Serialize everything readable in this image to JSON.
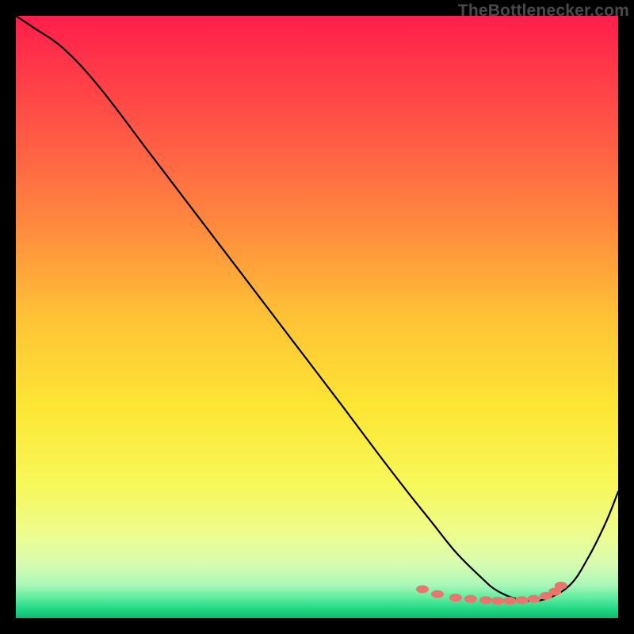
{
  "watermark": "TheBottlenecker.com",
  "chart_data": {
    "type": "line",
    "title": "",
    "xlabel": "",
    "ylabel": "",
    "xlim": [
      0,
      100
    ],
    "ylim": [
      0,
      100
    ],
    "background_gradient": {
      "stops": [
        {
          "offset": 0.0,
          "color": "#ff1e4b"
        },
        {
          "offset": 0.1,
          "color": "#ff3c48"
        },
        {
          "offset": 0.22,
          "color": "#ff6044"
        },
        {
          "offset": 0.35,
          "color": "#ff8a3e"
        },
        {
          "offset": 0.5,
          "color": "#ffc235"
        },
        {
          "offset": 0.65,
          "color": "#fde634"
        },
        {
          "offset": 0.78,
          "color": "#f7f85a"
        },
        {
          "offset": 0.86,
          "color": "#eefc8e"
        },
        {
          "offset": 0.91,
          "color": "#d7fcb0"
        },
        {
          "offset": 0.945,
          "color": "#a9f7b8"
        },
        {
          "offset": 0.965,
          "color": "#62eda0"
        },
        {
          "offset": 0.985,
          "color": "#20d884"
        },
        {
          "offset": 1.0,
          "color": "#0fb872"
        }
      ]
    },
    "curve": {
      "x": [
        0,
        3,
        8,
        14,
        22,
        30,
        38,
        46,
        54,
        60,
        65,
        69,
        73,
        77,
        80,
        84,
        88,
        92,
        95,
        98,
        100
      ],
      "y": [
        100,
        98,
        94.5,
        88,
        77.5,
        67,
        56.5,
        46,
        35.5,
        27.5,
        21,
        16,
        11,
        7,
        4.5,
        3,
        3.2,
        5.5,
        10,
        16,
        21
      ]
    },
    "scatter": {
      "x": [
        67.5,
        70,
        73,
        75.5,
        78,
        80,
        82,
        84,
        86,
        88,
        89.5,
        90.5
      ],
      "y": [
        4.8,
        4.0,
        3.4,
        3.2,
        3.0,
        2.9,
        2.9,
        3.0,
        3.2,
        3.7,
        4.4,
        5.4
      ]
    },
    "scatter_color": "#e9766c",
    "curve_color": "#000000"
  }
}
